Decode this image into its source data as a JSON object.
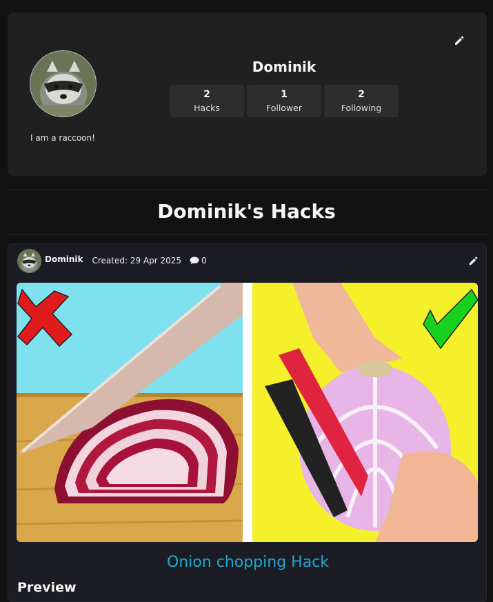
{
  "profile": {
    "username": "Dominik",
    "bio": "I am a raccoon!",
    "avatar_icon": "raccoon-avatar",
    "stats": [
      {
        "count": "2",
        "label": "Hacks"
      },
      {
        "count": "1",
        "label": "Follower"
      },
      {
        "count": "2",
        "label": "Following"
      }
    ],
    "edit_icon": "pencil-icon"
  },
  "section": {
    "title": "Dominik's Hacks"
  },
  "hack": {
    "author": "Dominik",
    "created": "Created: 29 Apr 2025",
    "comment_count": "0",
    "comment_icon": "comment-icon",
    "edit_icon": "pencil-icon",
    "image_icon": "onion-comparison-image",
    "title": "Onion chopping Hack",
    "preview_heading": "Preview"
  },
  "colors": {
    "background": "#121212",
    "card": "#202020",
    "stat_box": "#2d2d2d",
    "hack_card": "#1c1d24",
    "link": "#1fa8cf"
  }
}
